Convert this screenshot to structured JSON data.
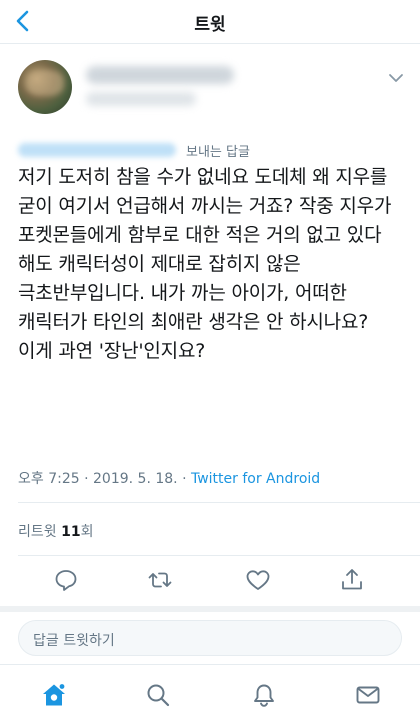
{
  "header": {
    "title": "트윗",
    "back_icon": "chevron-left-icon"
  },
  "colors": {
    "accent": "#1b95e0",
    "text_primary": "#14171a",
    "text_secondary": "#657786"
  },
  "tweet": {
    "reply_to_label": "보내는 답글",
    "body": "저기 도저히 참을 수가 없네요 도데체 왜 지우를 굳이 여기서 언급해서 까시는 거죠? 작중 지우가 포켓몬들에게 함부로 대한 적은 거의 없고 있다 해도 캐릭터성이 제대로 잡히지 않은 극초반부입니다. 내가 까는 아이가, 어떠한 캐릭터가 타인의 최애란 생각은 안 하시나요? 이게 과연 '장난'인지요?",
    "time": "오후 7:25",
    "separator": "·",
    "date": "2019. 5. 18.",
    "source": "Twitter for Android"
  },
  "stats": {
    "retweets_label": "리트윗",
    "retweets_count": "11",
    "retweets_suffix": "회"
  },
  "actions": [
    "reply-icon",
    "retweet-icon",
    "like-icon",
    "share-icon"
  ],
  "reply_input": {
    "placeholder": "답글 트윗하기"
  },
  "tabbar": {
    "items": [
      "home-icon",
      "search-icon",
      "notifications-icon",
      "messages-icon"
    ],
    "active": "home-icon"
  }
}
